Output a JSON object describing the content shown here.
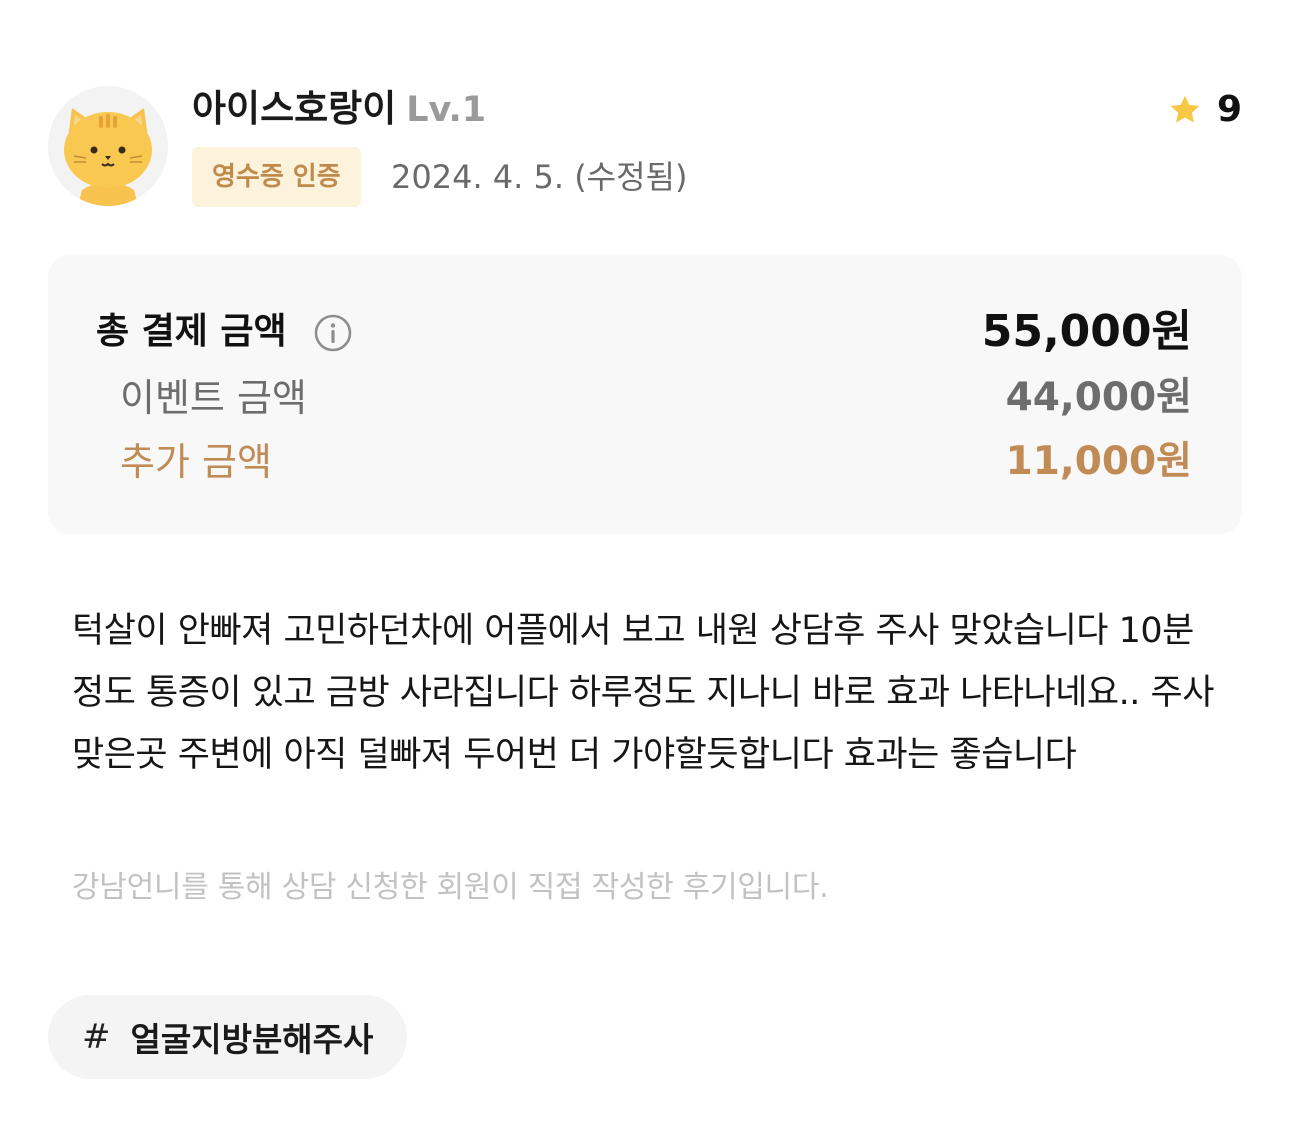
{
  "author": {
    "name": "아이스호랑이",
    "level": "Lv.1",
    "avatar_icon": "cat-avatar-icon"
  },
  "verification_badge": "영수증 인증",
  "date": "2024. 4. 5. (수정됨)",
  "rating": {
    "icon": "star-icon",
    "value": "9",
    "color": "#F7C843"
  },
  "payment": {
    "total_label": "총 결제 금액",
    "total_amount": "55,000원",
    "info_icon": "info-icon",
    "event_label": "이벤트 금액",
    "event_amount": "44,000원",
    "extra_label": "추가 금액",
    "extra_amount": "11,000원",
    "accent_color": "#C18B55"
  },
  "review": {
    "text": "턱살이 안빠져 고민하던차에 어플에서 보고 내원 상담후 주사 맞았습니다 10분정도 통증이 있고 금방 사라집니다 하루정도 지나니 바로 효과 나타나네요.. 주사맞은곳 주변에 아직 덜빠져 두어번 더 가야할듯합니다 효과는 좋습니다",
    "notice": "강남언니를 통해 상담 신청한 회원이 직접 작성한 후기입니다."
  },
  "tags": [
    {
      "hash": "#",
      "label": "얼굴지방분해주사"
    }
  ]
}
